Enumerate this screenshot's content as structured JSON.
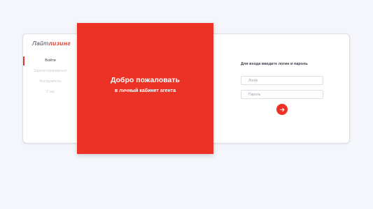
{
  "logo": {
    "part1": "Лайт",
    "part2": "лизинг"
  },
  "nav": {
    "items": [
      {
        "label": "Войти",
        "active": true
      },
      {
        "label": "Зарегистрироваться",
        "active": false
      },
      {
        "label": "Инструменты",
        "active": false
      },
      {
        "label": "О нас",
        "active": false
      }
    ]
  },
  "hero": {
    "title": "Добро пожаловать",
    "subtitle": "в личный кабинет агента"
  },
  "form": {
    "title": "Для входа введите логин и пароль",
    "login_placeholder": "Логин",
    "password_placeholder": "Пароль",
    "submit_icon": "arrow-right-icon"
  },
  "colors": {
    "accent": "#ec3224",
    "background": "#f4f6fb",
    "text": "#3a3f4a"
  }
}
